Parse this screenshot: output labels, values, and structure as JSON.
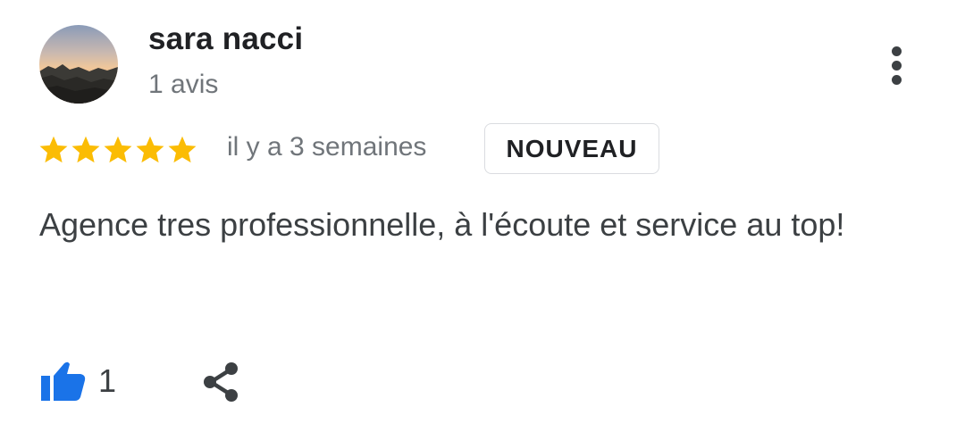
{
  "reviewer": {
    "name": "sara nacci",
    "review_count": "1 avis"
  },
  "rating": {
    "stars": 5,
    "max_stars": 5,
    "star_color": "#FBBC04"
  },
  "meta": {
    "date": "il y a 3 semaines",
    "badge": "NOUVEAU"
  },
  "review": {
    "text": "Agence tres professionnelle, à l'écoute et service au top!"
  },
  "actions": {
    "like_count": "1",
    "like_color": "#1a73e8",
    "like_icon": "thumbs-up-icon",
    "share_icon": "share-icon",
    "menu_icon": "more-vert-icon"
  }
}
